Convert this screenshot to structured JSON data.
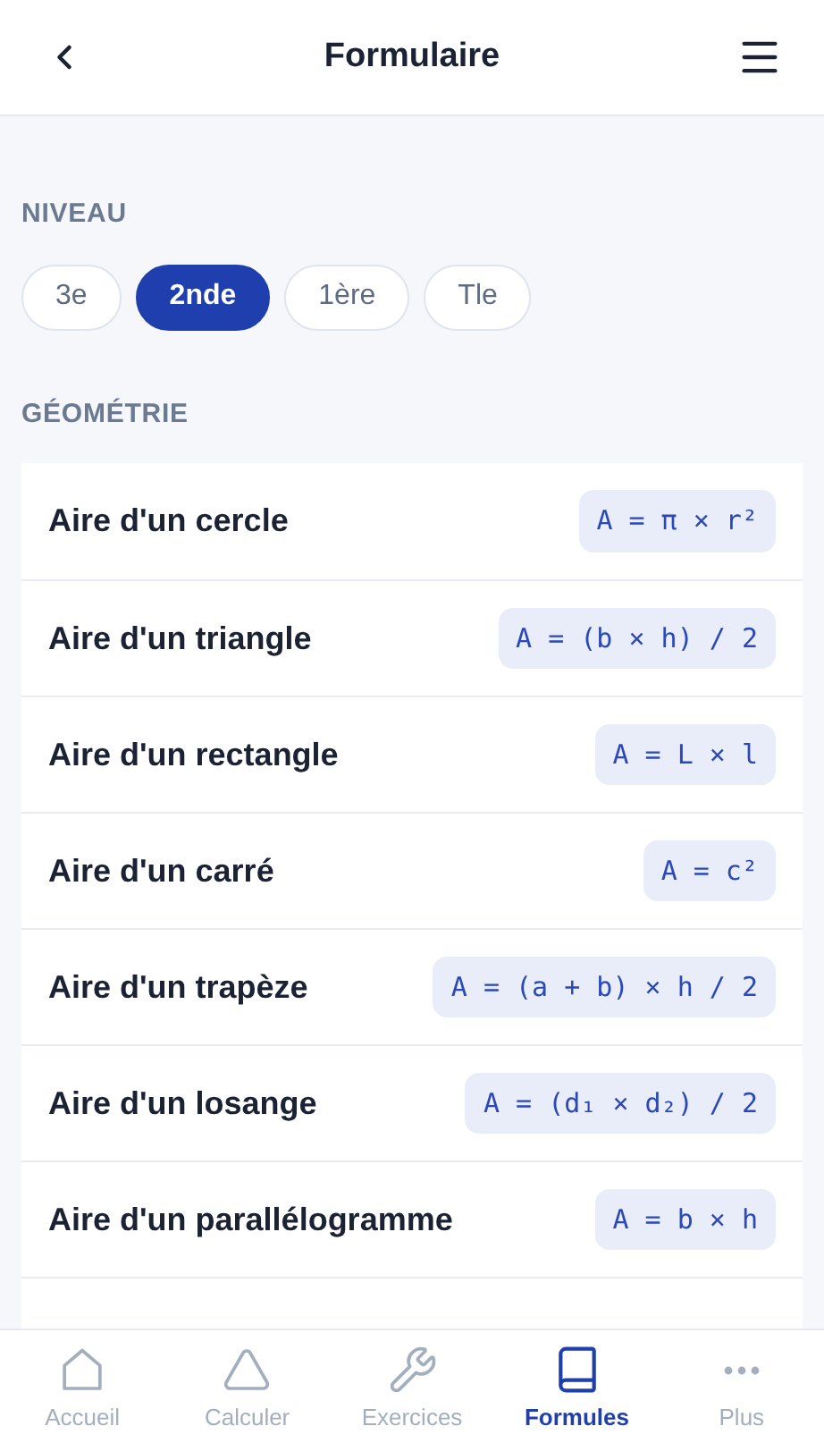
{
  "header": {
    "title": "Formulaire"
  },
  "level_section": {
    "label": "NIVEAU",
    "chips": [
      {
        "label": "3e",
        "selected": false
      },
      {
        "label": "2nde",
        "selected": true
      },
      {
        "label": "1ère",
        "selected": false
      },
      {
        "label": "Tle",
        "selected": false
      }
    ]
  },
  "geometry_section": {
    "label": "GÉOMÉTRIE",
    "formulas": [
      {
        "name": "Aire d'un cercle",
        "formula": "A = π × r²"
      },
      {
        "name": "Aire d'un triangle",
        "formula": "A = (b × h) / 2"
      },
      {
        "name": "Aire d'un rectangle",
        "formula": "A = L × l"
      },
      {
        "name": "Aire d'un carré",
        "formula": "A = c²"
      },
      {
        "name": "Aire d'un trapèze",
        "formula": "A = (a + b) × h / 2"
      },
      {
        "name": "Aire d'un losange",
        "formula": "A = (d₁ × d₂) / 2"
      },
      {
        "name": "Aire d'un parallélogramme",
        "formula": "A = b × h"
      }
    ]
  },
  "bottom_nav": [
    {
      "label": "Accueil",
      "selected": false
    },
    {
      "label": "Calculer",
      "selected": false
    },
    {
      "label": "Exercices",
      "selected": false
    },
    {
      "label": "Formules",
      "selected": true
    },
    {
      "label": "Plus",
      "selected": false
    }
  ]
}
